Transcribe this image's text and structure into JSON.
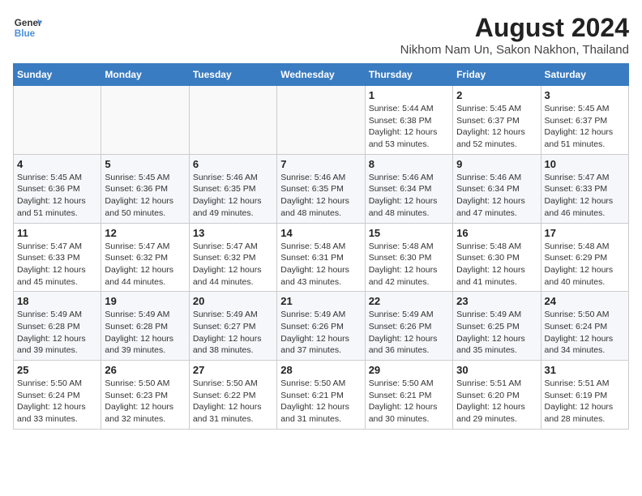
{
  "logo": {
    "line1": "General",
    "line2": "Blue"
  },
  "title": "August 2024",
  "subtitle": "Nikhom Nam Un, Sakon Nakhon, Thailand",
  "weekdays": [
    "Sunday",
    "Monday",
    "Tuesday",
    "Wednesday",
    "Thursday",
    "Friday",
    "Saturday"
  ],
  "weeks": [
    [
      {
        "day": "",
        "info": ""
      },
      {
        "day": "",
        "info": ""
      },
      {
        "day": "",
        "info": ""
      },
      {
        "day": "",
        "info": ""
      },
      {
        "day": "1",
        "info": "Sunrise: 5:44 AM\nSunset: 6:38 PM\nDaylight: 12 hours\nand 53 minutes."
      },
      {
        "day": "2",
        "info": "Sunrise: 5:45 AM\nSunset: 6:37 PM\nDaylight: 12 hours\nand 52 minutes."
      },
      {
        "day": "3",
        "info": "Sunrise: 5:45 AM\nSunset: 6:37 PM\nDaylight: 12 hours\nand 51 minutes."
      }
    ],
    [
      {
        "day": "4",
        "info": "Sunrise: 5:45 AM\nSunset: 6:36 PM\nDaylight: 12 hours\nand 51 minutes."
      },
      {
        "day": "5",
        "info": "Sunrise: 5:45 AM\nSunset: 6:36 PM\nDaylight: 12 hours\nand 50 minutes."
      },
      {
        "day": "6",
        "info": "Sunrise: 5:46 AM\nSunset: 6:35 PM\nDaylight: 12 hours\nand 49 minutes."
      },
      {
        "day": "7",
        "info": "Sunrise: 5:46 AM\nSunset: 6:35 PM\nDaylight: 12 hours\nand 48 minutes."
      },
      {
        "day": "8",
        "info": "Sunrise: 5:46 AM\nSunset: 6:34 PM\nDaylight: 12 hours\nand 48 minutes."
      },
      {
        "day": "9",
        "info": "Sunrise: 5:46 AM\nSunset: 6:34 PM\nDaylight: 12 hours\nand 47 minutes."
      },
      {
        "day": "10",
        "info": "Sunrise: 5:47 AM\nSunset: 6:33 PM\nDaylight: 12 hours\nand 46 minutes."
      }
    ],
    [
      {
        "day": "11",
        "info": "Sunrise: 5:47 AM\nSunset: 6:33 PM\nDaylight: 12 hours\nand 45 minutes."
      },
      {
        "day": "12",
        "info": "Sunrise: 5:47 AM\nSunset: 6:32 PM\nDaylight: 12 hours\nand 44 minutes."
      },
      {
        "day": "13",
        "info": "Sunrise: 5:47 AM\nSunset: 6:32 PM\nDaylight: 12 hours\nand 44 minutes."
      },
      {
        "day": "14",
        "info": "Sunrise: 5:48 AM\nSunset: 6:31 PM\nDaylight: 12 hours\nand 43 minutes."
      },
      {
        "day": "15",
        "info": "Sunrise: 5:48 AM\nSunset: 6:30 PM\nDaylight: 12 hours\nand 42 minutes."
      },
      {
        "day": "16",
        "info": "Sunrise: 5:48 AM\nSunset: 6:30 PM\nDaylight: 12 hours\nand 41 minutes."
      },
      {
        "day": "17",
        "info": "Sunrise: 5:48 AM\nSunset: 6:29 PM\nDaylight: 12 hours\nand 40 minutes."
      }
    ],
    [
      {
        "day": "18",
        "info": "Sunrise: 5:49 AM\nSunset: 6:28 PM\nDaylight: 12 hours\nand 39 minutes."
      },
      {
        "day": "19",
        "info": "Sunrise: 5:49 AM\nSunset: 6:28 PM\nDaylight: 12 hours\nand 39 minutes."
      },
      {
        "day": "20",
        "info": "Sunrise: 5:49 AM\nSunset: 6:27 PM\nDaylight: 12 hours\nand 38 minutes."
      },
      {
        "day": "21",
        "info": "Sunrise: 5:49 AM\nSunset: 6:26 PM\nDaylight: 12 hours\nand 37 minutes."
      },
      {
        "day": "22",
        "info": "Sunrise: 5:49 AM\nSunset: 6:26 PM\nDaylight: 12 hours\nand 36 minutes."
      },
      {
        "day": "23",
        "info": "Sunrise: 5:49 AM\nSunset: 6:25 PM\nDaylight: 12 hours\nand 35 minutes."
      },
      {
        "day": "24",
        "info": "Sunrise: 5:50 AM\nSunset: 6:24 PM\nDaylight: 12 hours\nand 34 minutes."
      }
    ],
    [
      {
        "day": "25",
        "info": "Sunrise: 5:50 AM\nSunset: 6:24 PM\nDaylight: 12 hours\nand 33 minutes."
      },
      {
        "day": "26",
        "info": "Sunrise: 5:50 AM\nSunset: 6:23 PM\nDaylight: 12 hours\nand 32 minutes."
      },
      {
        "day": "27",
        "info": "Sunrise: 5:50 AM\nSunset: 6:22 PM\nDaylight: 12 hours\nand 31 minutes."
      },
      {
        "day": "28",
        "info": "Sunrise: 5:50 AM\nSunset: 6:21 PM\nDaylight: 12 hours\nand 31 minutes."
      },
      {
        "day": "29",
        "info": "Sunrise: 5:50 AM\nSunset: 6:21 PM\nDaylight: 12 hours\nand 30 minutes."
      },
      {
        "day": "30",
        "info": "Sunrise: 5:51 AM\nSunset: 6:20 PM\nDaylight: 12 hours\nand 29 minutes."
      },
      {
        "day": "31",
        "info": "Sunrise: 5:51 AM\nSunset: 6:19 PM\nDaylight: 12 hours\nand 28 minutes."
      }
    ]
  ]
}
